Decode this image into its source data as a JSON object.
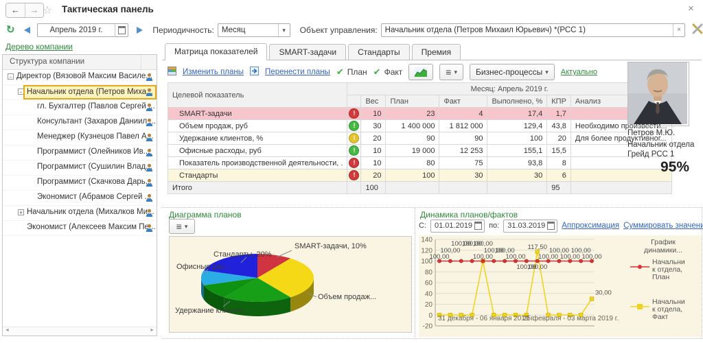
{
  "window": {
    "title": "Тактическая панель"
  },
  "icons": {
    "back": "←",
    "forward": "→",
    "star": "☆",
    "close": "×",
    "refresh": "↻",
    "dropdown": "▾",
    "clear": "×",
    "check": "✔",
    "hamburger": "≡",
    "minus": "-",
    "plus": "+",
    "scroll_left": "◄",
    "scroll_right": "►"
  },
  "toolbar": {
    "period_value": "Апрель 2019 г.",
    "periodicity_label": "Периодичность:",
    "periodicity_value": "Месяц",
    "object_label": "Объект управления:",
    "object_value": "Начальник отдела (Петров Михаил Юрьевич) *(РСС 1)"
  },
  "sidebar": {
    "title": "Дерево компании",
    "column_header": "Структура компании",
    "items": [
      {
        "label": "Директор (Вязовой Максим Василе...",
        "level": 0,
        "expander": "minus",
        "selected": false
      },
      {
        "label": "Начальник отдела (Петров Миха...",
        "level": 1,
        "expander": "minus",
        "selected": true
      },
      {
        "label": "гл. Бухгалтер (Павлов Сергей ...",
        "level": 2,
        "expander": "none",
        "selected": false
      },
      {
        "label": "Консультант (Захаров Даниил ...",
        "level": 2,
        "expander": "none",
        "selected": false
      },
      {
        "label": "Менеджер (Кузнецов Павел А...",
        "level": 2,
        "expander": "none",
        "selected": false
      },
      {
        "label": "Программист (Олейников Ив...",
        "level": 2,
        "expander": "none",
        "selected": false
      },
      {
        "label": "Программист (Сушилин Влад...",
        "level": 2,
        "expander": "none",
        "selected": false
      },
      {
        "label": "Программист (Скачкова Дарь...",
        "level": 2,
        "expander": "none",
        "selected": false
      },
      {
        "label": "Экономист (Абрамов Сергей ...",
        "level": 2,
        "expander": "none",
        "selected": false
      },
      {
        "label": "Начальник отдела (Михалков Ми...",
        "level": 1,
        "expander": "plus",
        "selected": false
      },
      {
        "label": "Экономист (Алексеев Максим Пе...",
        "level": 1,
        "expander": "none",
        "selected": false
      }
    ]
  },
  "tabs": [
    {
      "label": "Матрица показателей",
      "active": true
    },
    {
      "label": "SMART-задачи",
      "active": false
    },
    {
      "label": "Стандарты",
      "active": false
    },
    {
      "label": "Премия",
      "active": false
    }
  ],
  "actions": {
    "edit_plans": "Изменить планы",
    "transfer_plans": "Перенести планы",
    "plan_check": "План",
    "fact_check": "Факт",
    "business_processes": "Бизнес-процессы",
    "actual": "Актуально"
  },
  "matrix": {
    "target_column": "Целевой показатель",
    "month_header": "Месяц: Апрель 2019 г.",
    "columns": [
      "Вес",
      "План",
      "Факт",
      "Выполнено, %",
      "КПР",
      "Анализ"
    ],
    "rows": [
      {
        "name": "SMART-задачи",
        "status": "red",
        "highlight": "pink",
        "ves": "10",
        "plan": "23",
        "fact": "4",
        "done": "17,4",
        "kpr": "1,7",
        "analysis": ""
      },
      {
        "name": "Объем продаж, руб",
        "status": "green",
        "highlight": "",
        "ves": "30",
        "plan": "1 400 000",
        "fact": "1 812 000",
        "done": "129,4",
        "kpr": "43,8",
        "analysis": "Необходимо произвести..."
      },
      {
        "name": "Удержание клиентов, %",
        "status": "yellow",
        "highlight": "",
        "ves": "20",
        "plan": "90",
        "fact": "90",
        "done": "100",
        "kpr": "20",
        "analysis": "Для более продуктивног..."
      },
      {
        "name": "Офисные расходы, руб",
        "status": "green",
        "highlight": "",
        "ves": "10",
        "plan": "19 000",
        "fact": "12 253",
        "done": "155,1",
        "kpr": "15,5",
        "analysis": ""
      },
      {
        "name": "Показатель производственной деятельности, .",
        "status": "red",
        "highlight": "",
        "ves": "10",
        "plan": "80",
        "fact": "75",
        "done": "93,8",
        "kpr": "8",
        "analysis": ""
      },
      {
        "name": "Стандарты",
        "status": "red",
        "highlight": "yellow",
        "ves": "20",
        "plan": "100",
        "fact": "30",
        "done": "30",
        "kpr": "6",
        "analysis": ""
      }
    ],
    "total": {
      "label": "Итого",
      "ves": "100",
      "kpr": "95"
    }
  },
  "profile": {
    "name": "Петров М.Ю.",
    "position": "Начальник отдела",
    "grade": "Грейд РСС 1",
    "percent": "95%"
  },
  "plans_chart": {
    "title": "Диаграмма планов"
  },
  "dynamics": {
    "title": "Динамика планов/фактов",
    "from_label": "С:",
    "from_value": "01.01.2019",
    "to_label": "по:",
    "to_value": "31.03.2019",
    "approx_link": "Аппроксимация",
    "sum_link": "Суммировать значения"
  },
  "colors": {
    "accent_green": "#2e8b3a",
    "link_blue": "#3565c0",
    "pink_row": "#f7c6cc",
    "yellow_row": "#fcf7dc",
    "chart_bg": "#faf5e2",
    "plan_red": "#d93535",
    "fact_yellow": "#f0d322"
  },
  "chart_data": [
    {
      "type": "pie",
      "title": "Диаграмма планов",
      "unit": "%",
      "slices": [
        {
          "label": "SMART-задачи",
          "value": 10,
          "color": "#cf3440",
          "callout": "SMART-задачи, 10%"
        },
        {
          "label": "Объем продаж",
          "value": 30,
          "color": "#f5d916",
          "callout": "Объем продаж..."
        },
        {
          "label": "Удержание клиентов",
          "value": 20,
          "color": "#17a017",
          "callout": "Удержание клиенто..."
        },
        {
          "label": "Показатель производственной деятельности",
          "value": 10,
          "color": "#0f9212",
          "callout": ""
        },
        {
          "label": "Офисные расходы",
          "value": 10,
          "color": "#29ade4",
          "callout": "Офисные рас..."
        },
        {
          "label": "Стандарты",
          "value": 20,
          "color": "#2121dc",
          "callout": "Стандарты, 20%"
        }
      ]
    },
    {
      "type": "line",
      "title": "График динамики...",
      "legend_title_lines": [
        "График",
        "динамики..."
      ],
      "ylim": [
        -20,
        140
      ],
      "ytick_step": 20,
      "x_axis_labels": [
        "31 декабря - 06 января 2019 г.",
        "25 февраля - 03 марта 2019 г."
      ],
      "series": [
        {
          "name": "Начальни к отдела, План",
          "name_lines": [
            "Начальни",
            "к отдела,",
            "План"
          ],
          "color": "#d93535",
          "marker": "circle",
          "values": [
            100,
            100,
            100,
            100,
            100,
            100,
            100,
            100,
            100,
            100,
            100,
            100,
            100,
            100,
            100
          ]
        },
        {
          "name": "Начальни к отдела, Факт",
          "name_lines": [
            "Начальни",
            "к отдела,",
            "Факт"
          ],
          "color": "#f0d322",
          "marker": "square",
          "values": [
            0,
            0,
            0,
            0,
            100,
            0,
            0,
            0,
            0,
            117.5,
            0,
            0,
            0,
            0,
            30
          ]
        }
      ]
    }
  ]
}
